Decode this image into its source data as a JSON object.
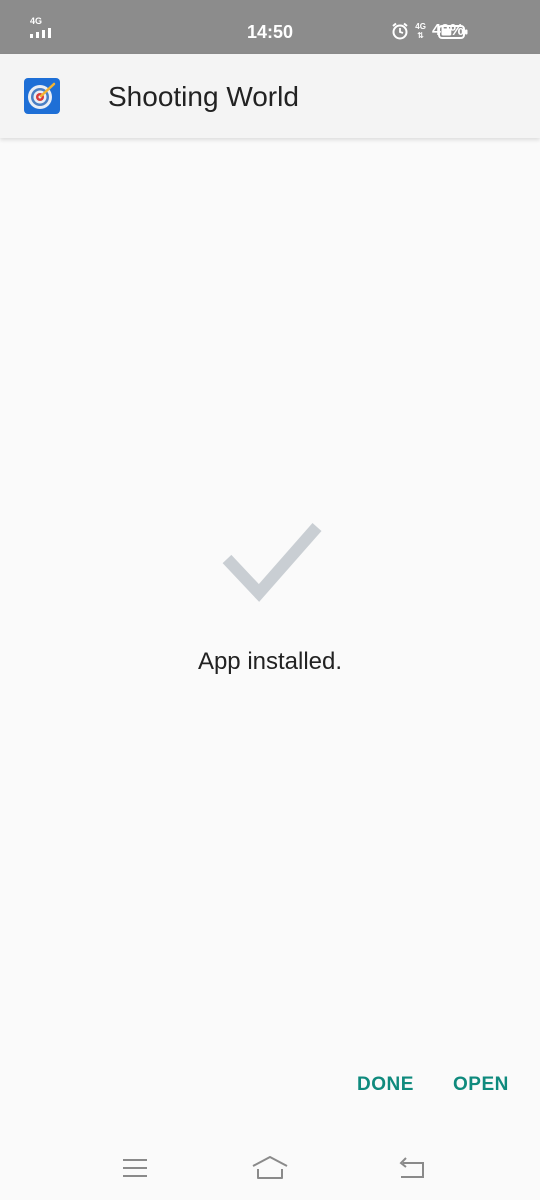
{
  "status_bar": {
    "network_type_left": "4G",
    "time": "14:50",
    "network_type_right": "4G",
    "battery_percent": "49%",
    "battery_level": 0.49
  },
  "app_bar": {
    "title": "Shooting World",
    "icon": "target-icon"
  },
  "content": {
    "status_icon": "checkmark-icon",
    "message": "App installed."
  },
  "actions": {
    "done_label": "DONE",
    "open_label": "OPEN"
  },
  "nav_bar": {
    "icons": [
      "menu-icon",
      "home-icon",
      "back-icon"
    ]
  },
  "colors": {
    "status_bar_bg": "#8c8c8c",
    "accent": "#0f8a7d",
    "checkmark": "#c9ced3",
    "background": "#fafafa"
  }
}
